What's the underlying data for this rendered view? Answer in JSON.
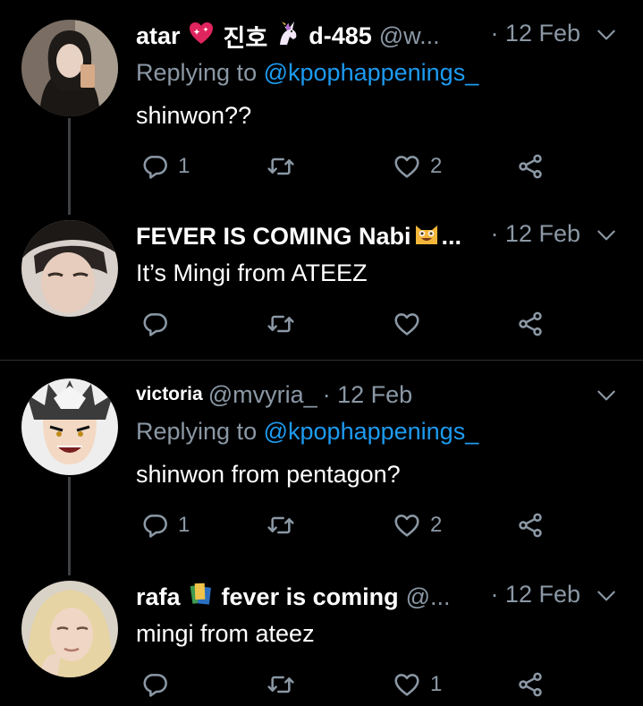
{
  "tweets": [
    {
      "display_name": "atar",
      "name_suffix": "진호",
      "name_tail": "d-485",
      "handle": "@w...",
      "time": "· 12 Feb",
      "replying_label": "Replying to",
      "replying_to": "@kpophappenings_",
      "text": "shinwon??",
      "replies": "1",
      "retweets": "",
      "likes": "2"
    },
    {
      "display_name": "FEVER IS COMING Nabi",
      "name_tail": "...",
      "time": "· 12 Feb",
      "text": "It’s Mingi from ATEEZ",
      "replies": "",
      "retweets": "",
      "likes": ""
    },
    {
      "display_name": "victoria",
      "handle": "@mvyria_",
      "time": "· 12 Feb",
      "replying_label": "Replying to",
      "replying_to": "@kpophappenings_",
      "text": "shinwon from pentagon?",
      "replies": "1",
      "retweets": "",
      "likes": "2"
    },
    {
      "display_name": "rafa",
      "name_tail": "fever is coming",
      "handle": "@...",
      "time": "· 12 Feb",
      "text": "mingi from ateez",
      "replies": "",
      "retweets": "",
      "likes": "1"
    }
  ],
  "colors": {
    "background": "#000000",
    "secondary": "#8b98a5",
    "mention": "#1d9bf0",
    "divider": "#2f3336"
  },
  "icons": [
    "reply-icon",
    "retweet-icon",
    "like-icon",
    "share-icon",
    "chevron-down-icon"
  ]
}
